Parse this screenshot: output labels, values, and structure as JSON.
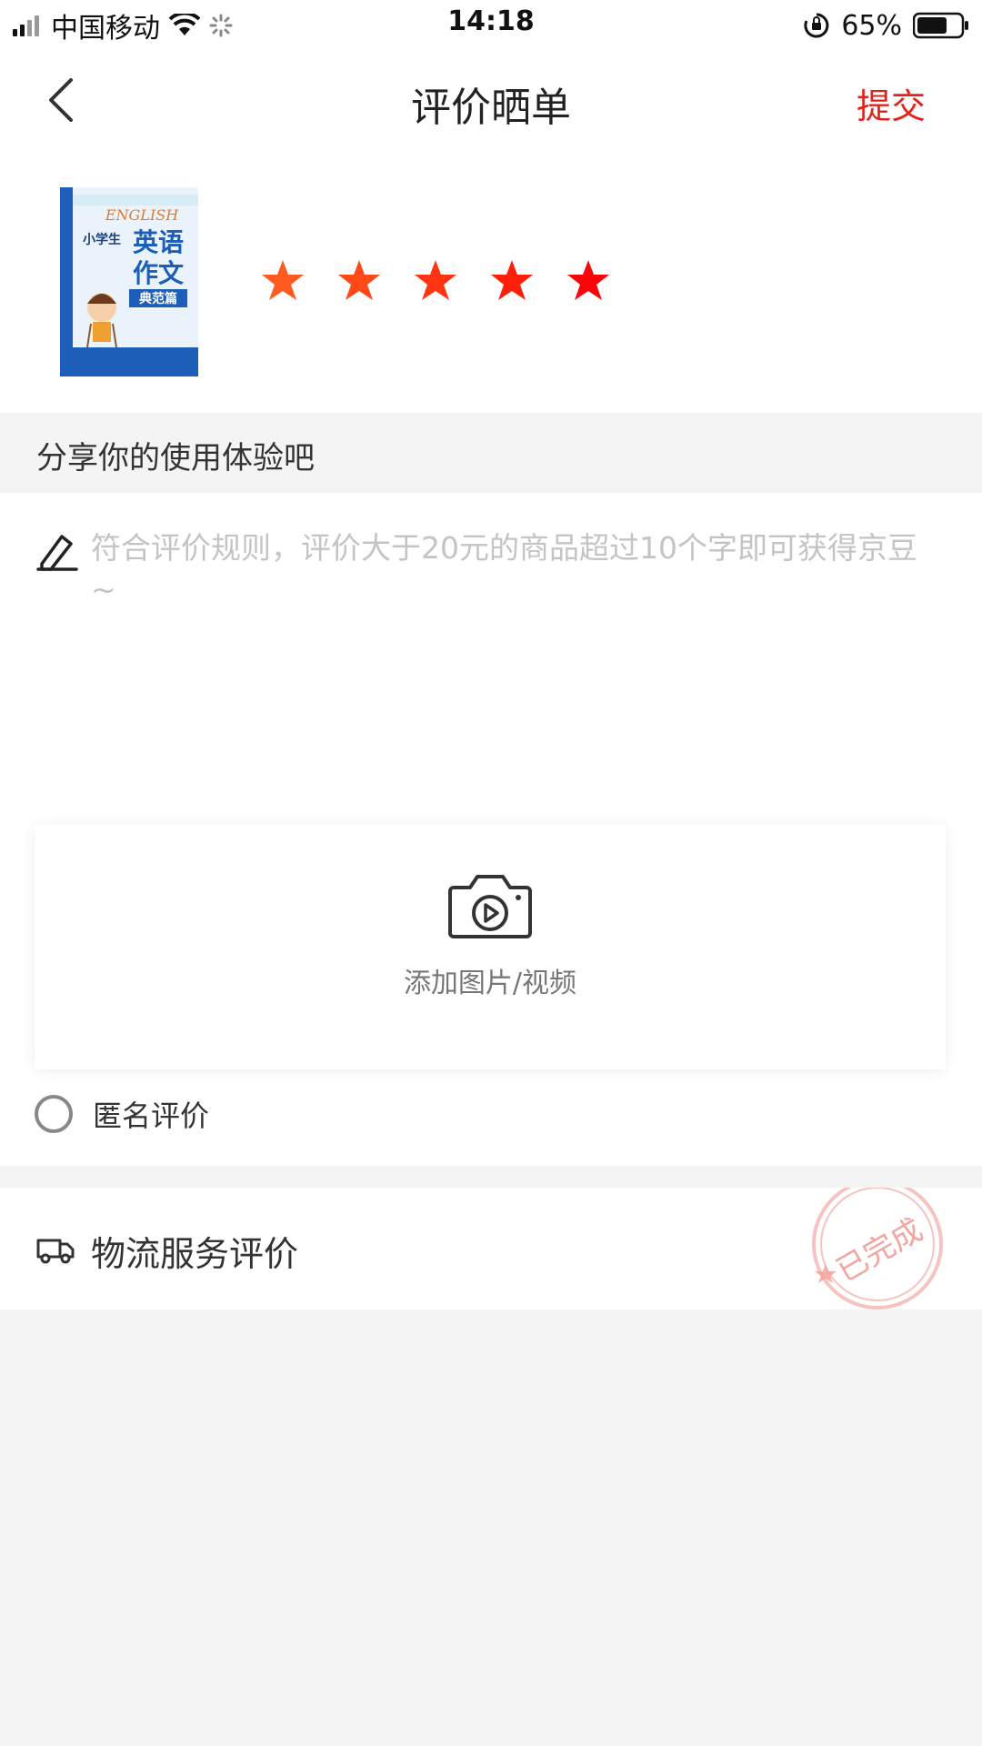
{
  "status_bar": {
    "carrier": "中国移动",
    "time": "14:18",
    "battery": "65%"
  },
  "nav": {
    "title": "评价晒单",
    "submit_label": "提交"
  },
  "product": {
    "rating": 5,
    "max_rating": 5,
    "book_cover": {
      "top_text": "ENGLISH",
      "line1": "小学生",
      "line2": "英语",
      "line3": "作文",
      "line4": "典范篇"
    }
  },
  "review": {
    "section_title": "分享你的使用体验吧",
    "placeholder": "符合评价规则，评价大于20元的商品超过10个字即可获得京豆~",
    "upload_label": "添加图片/视频",
    "anonymous_label": "匿名评价"
  },
  "logistics": {
    "label": "物流服务评价",
    "stamp_text": "已完成"
  },
  "colors": {
    "accent": "#e2231a",
    "star_gradient": [
      "#ff5a1f",
      "#ff4a18",
      "#ff3412",
      "#ff1f0b",
      "#f7070a"
    ]
  }
}
